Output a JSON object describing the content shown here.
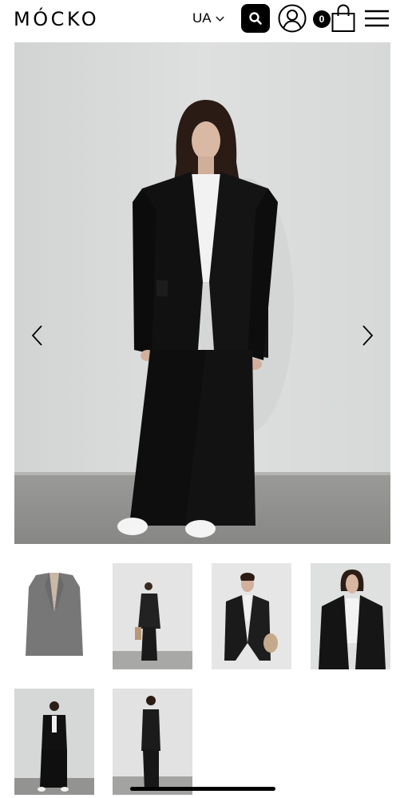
{
  "header": {
    "logo": "MÓCKO",
    "language": "UA",
    "cart_count": "0"
  },
  "icons": {
    "search": "search-icon",
    "user": "user-icon",
    "cart": "shopping-bag-icon",
    "menu": "hamburger-menu-icon",
    "prev": "chevron-left-icon",
    "next": "chevron-right-icon",
    "lang_caret": "chevron-down-icon"
  },
  "gallery": {
    "main_image": "model-in-black-oversized-suit-front",
    "thumbnails": [
      "black-blazer-flat-lay",
      "model-full-body-with-bag",
      "model-blazer-closeup-with-bag",
      "model-blazer-front-closeup",
      "model-full-body-front",
      "model-full-body-side"
    ],
    "selected_index": 0
  },
  "colors": {
    "accent": "#000000",
    "background": "#ffffff",
    "photo_wall": "#dcdcdc",
    "photo_floor": "#8e8e8c"
  }
}
